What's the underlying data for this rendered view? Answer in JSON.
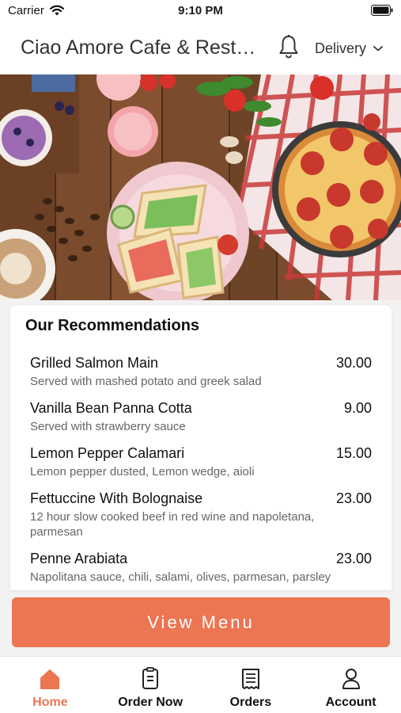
{
  "status_bar": {
    "carrier": "Carrier",
    "time": "9:10 PM"
  },
  "header": {
    "title": "Ciao Amore Cafe & Restaurant",
    "delivery_label": "Delivery"
  },
  "recommendations": {
    "title": "Our Recommendations",
    "items": [
      {
        "name": "Grilled Salmon Main",
        "price": "30.00",
        "description": "Served with mashed potato and greek salad"
      },
      {
        "name": "Vanilla Bean Panna Cotta",
        "price": "9.00",
        "description": "Served with strawberry sauce"
      },
      {
        "name": "Lemon Pepper Calamari",
        "price": "15.00",
        "description": "Lemon pepper dusted, Lemon wedge, aioli"
      },
      {
        "name": "Fettuccine With Bolognaise",
        "price": "23.00",
        "description": "12 hour slow cooked beef in red wine and napoletana, parmesan"
      },
      {
        "name": "Penne Arabiata",
        "price": "23.00",
        "description": "Napolitana sauce, chili, salami, olives, parmesan, parsley"
      }
    ]
  },
  "view_menu_label": "View Menu",
  "tabs": [
    {
      "label": "Home",
      "icon": "home-icon",
      "active": true
    },
    {
      "label": "Order Now",
      "icon": "order-icon",
      "active": false
    },
    {
      "label": "Orders",
      "icon": "receipt-icon",
      "active": false
    },
    {
      "label": "Account",
      "icon": "person-icon",
      "active": false
    }
  ],
  "colors": {
    "accent": "#ec7652",
    "text": "#111111",
    "muted": "#666666"
  }
}
